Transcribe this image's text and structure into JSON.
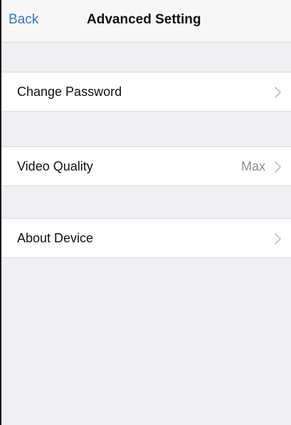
{
  "navbar": {
    "back_label": "Back",
    "title": "Advanced Setting"
  },
  "settings": {
    "items": [
      {
        "label": "Change Password",
        "value": ""
      },
      {
        "label": "Video Quality",
        "value": "Max"
      },
      {
        "label": "About Device",
        "value": ""
      }
    ]
  },
  "icons": {
    "chevron": "chevron-right-icon"
  },
  "colors": {
    "accent": "#3478c6",
    "background": "#efeff4",
    "chevron": "#c7c7cc"
  }
}
